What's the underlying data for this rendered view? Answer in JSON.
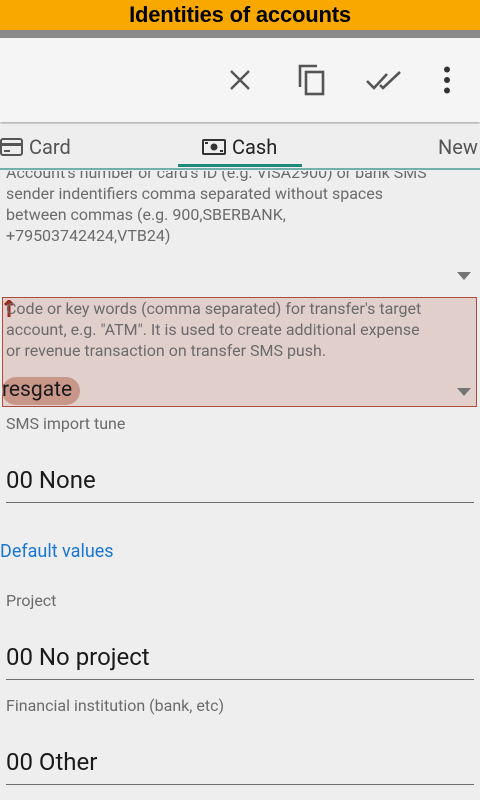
{
  "app_title": "Identities of accounts",
  "toolbar": {
    "close_icon": "close-icon",
    "copy_icon": "copy-icon",
    "done_all_icon": "done-all-icon",
    "more_icon": "more-vert-icon"
  },
  "tabs": [
    {
      "label": "Card",
      "icon": "card-icon"
    },
    {
      "label": "Cash",
      "icon": "cash-icon"
    },
    {
      "label": "New"
    }
  ],
  "sender_hint": {
    "line1": "Account's number or card's ID (e.g. VISA2900) or bank SMS",
    "line2": "sender indentifiers comma separated without spaces",
    "line3": "between commas (e.g. 900,SBERBANK,",
    "line4": "+79503742424,VTB24)"
  },
  "keywords_hint": {
    "line1": "Code or key words (comma separated) for transfer's target",
    "line2": "account, e.g. \"ATM\". It is used to create additional expense",
    "line3": "or revenue transaction on transfer SMS push.",
    "value": "resgate"
  },
  "sms_import": {
    "label": "SMS import tune",
    "value": "00 None"
  },
  "defaults_title": "Default values",
  "project": {
    "label": "Project",
    "value": "00 No project"
  },
  "institution": {
    "label": "Financial institution (bank, etc)",
    "value": "00 Other"
  },
  "colors": {
    "title_bg": "#f9a800",
    "accent": "#1c8a7a",
    "link": "#1976d2"
  }
}
